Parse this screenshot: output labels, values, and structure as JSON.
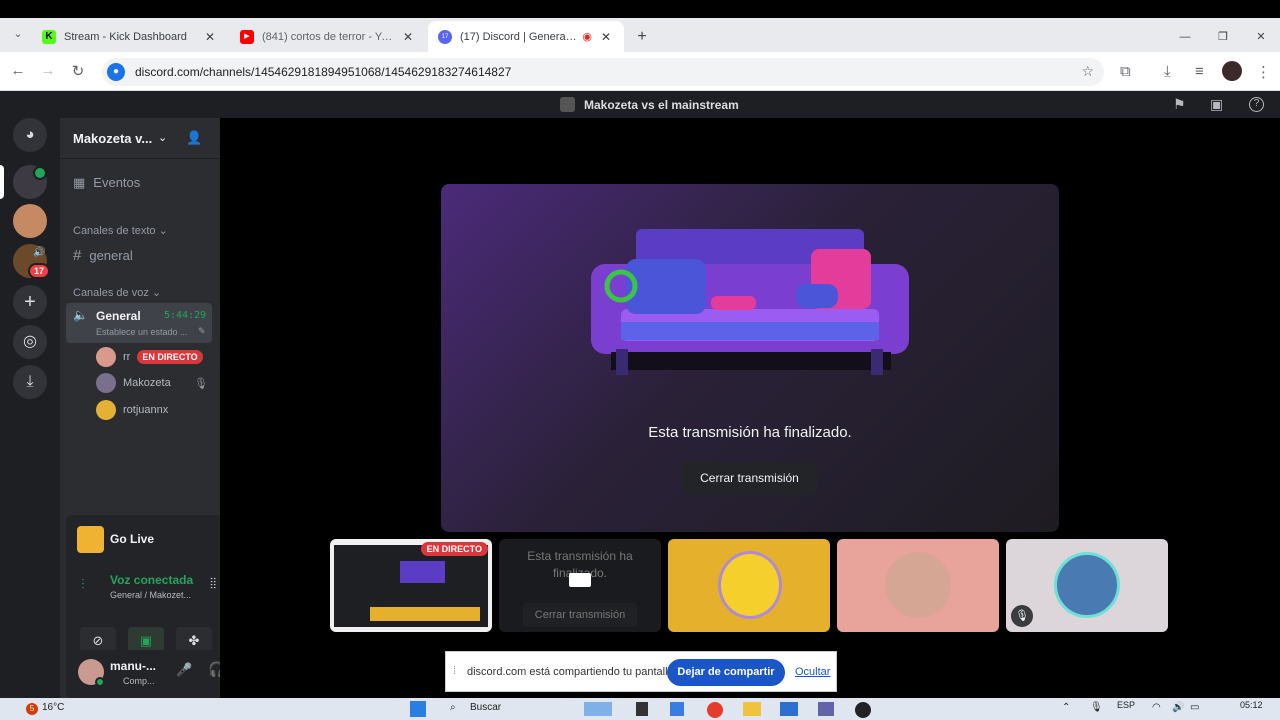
{
  "browser": {
    "tabs": [
      {
        "title": "Stream - Kick Dashboard",
        "favicon_color": "#53fc18",
        "favicon_glyph": "K"
      },
      {
        "title": "(841) cortos de terror - YouTube",
        "favicon_color": "#ff0000",
        "favicon_glyph": "▶"
      },
      {
        "title": "(17) Discord | General | Makozeta vs el mainstream",
        "favicon_color": "#5865f2",
        "favicon_glyph": "17"
      }
    ],
    "new_tab_icon": "+",
    "url": "discord.com/channels/1454629181894951068/1454629183274614827",
    "window_controls": [
      "—",
      "❐",
      "✕"
    ]
  },
  "discord": {
    "server_title": "Makozeta vs el mainstream",
    "server_name": "Makozeta v...",
    "events": "Eventos",
    "text_category": "Canales de texto",
    "text_channel": "general",
    "voice_category": "Canales de voz",
    "voice_channel": {
      "name": "General",
      "timer": "5:44:29",
      "status": "Establece un estado ..."
    },
    "members": [
      {
        "name": "rr",
        "live_badge": "EN DIRECTO",
        "avatar_color": "#d99a8d"
      },
      {
        "name": "Makozeta",
        "avatar_color": "#7a6f8c"
      },
      {
        "name": "rotjuannx",
        "avatar_color": "#e2b136"
      }
    ],
    "guild_badge": "17",
    "go_live": "Go Live",
    "voice_status": {
      "title": "Voz conectada",
      "subtitle": "General / Makozet..."
    },
    "user": {
      "name": "manu-...",
      "status": "Comp..."
    },
    "stream_ended": {
      "message": "Esta transmisión ha finalizado.",
      "button": "Cerrar transmisión"
    },
    "tiles": [
      {
        "kind": "screen",
        "badge": "EN DIRECTO"
      },
      {
        "kind": "ended",
        "message": "Esta transmisión ha finalizado.",
        "button": "Cerrar transmisión"
      },
      {
        "kind": "avatar",
        "bg": "#e5b12c"
      },
      {
        "kind": "avatar",
        "bg": "#e8a39a"
      },
      {
        "kind": "avatar",
        "bg": "#dcd6da"
      }
    ]
  },
  "share_bar": {
    "text": "discord.com está compartiendo tu pantalla.",
    "stop_button": "Dejar de compartir",
    "hide_link": "Ocultar"
  },
  "taskbar": {
    "weather": "16°C",
    "weather_badge": "5",
    "search": "Buscar",
    "lang": "ESP",
    "time": "05:12"
  }
}
